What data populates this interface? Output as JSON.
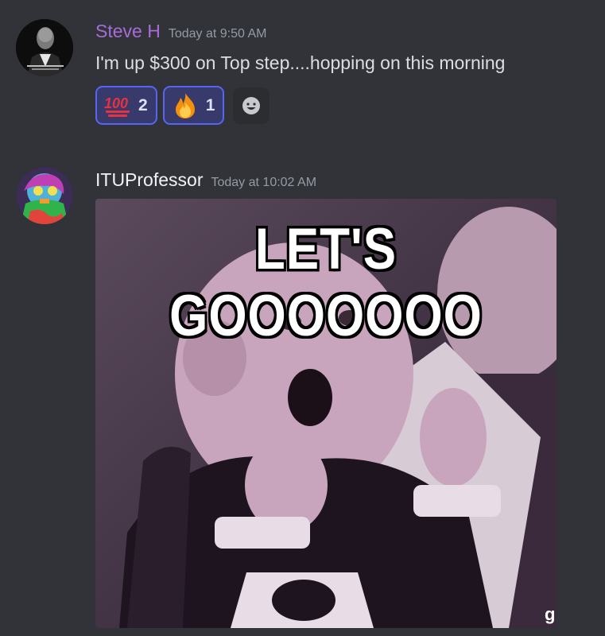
{
  "messages": [
    {
      "username": "Steve H",
      "timestamp": "Today at 9:50 AM",
      "text": "I'm up $300 on Top step....hopping on this morning",
      "reactions": [
        {
          "emoji": "hundred-points",
          "count": "2"
        },
        {
          "emoji": "fire",
          "count": "1"
        }
      ],
      "username_color": "#a86bd8"
    },
    {
      "username": "ITUProfessor",
      "timestamp": "Today at 10:02 AM",
      "gif": {
        "caption": "LET'S GOOOOOOO"
      }
    }
  ],
  "colors": {
    "background": "#313338",
    "reaction_border": "#5865f2",
    "reaction_bg": "#373a6b",
    "timestamp": "#949ba4",
    "text": "#dbdee1"
  }
}
